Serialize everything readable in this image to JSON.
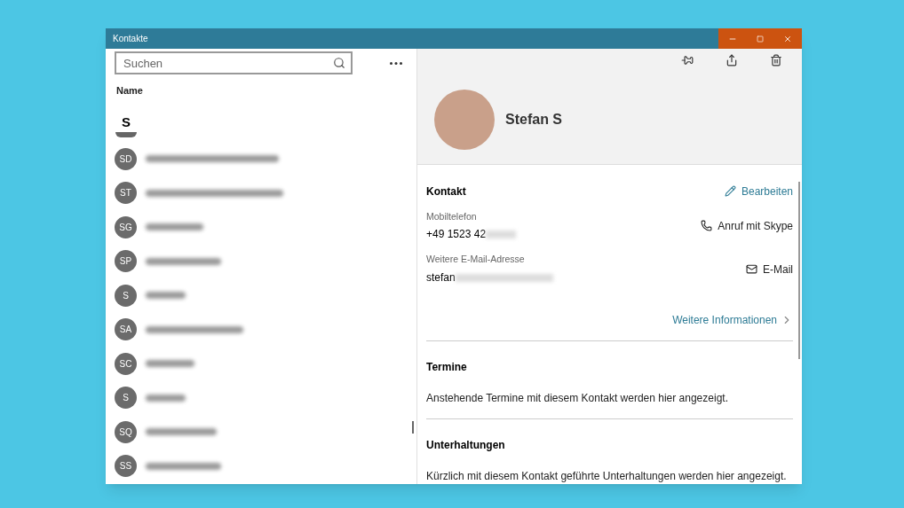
{
  "window": {
    "title": "Kontakte"
  },
  "search": {
    "placeholder": "Suchen"
  },
  "list": {
    "heading": "Name",
    "group_letter": "S",
    "contacts": [
      {
        "initials": "SD"
      },
      {
        "initials": "ST"
      },
      {
        "initials": "SG"
      },
      {
        "initials": "SP"
      },
      {
        "initials": "S"
      },
      {
        "initials": "SA"
      },
      {
        "initials": "SC"
      },
      {
        "initials": "S"
      },
      {
        "initials": "SQ"
      },
      {
        "initials": "SS"
      }
    ]
  },
  "contact": {
    "name": "Stefan S",
    "section": {
      "title": "Kontakt",
      "edit": "Bearbeiten",
      "fields": [
        {
          "kind": "phone",
          "label": "Mobiltelefon",
          "value": "+49 1523 42",
          "action": "Anruf mit Skype"
        },
        {
          "kind": "email",
          "label": "Weitere E-Mail-Adresse",
          "value": "stefan",
          "action": "E-Mail"
        }
      ],
      "more": "Weitere Informationen"
    },
    "panels": [
      {
        "title": "Termine",
        "text": "Anstehende Termine mit diesem Kontakt werden hier angezeigt."
      },
      {
        "title": "Unterhaltungen",
        "text": "Kürzlich mit diesem Kontakt geführte Unterhaltungen werden hier angezeigt."
      }
    ]
  }
}
